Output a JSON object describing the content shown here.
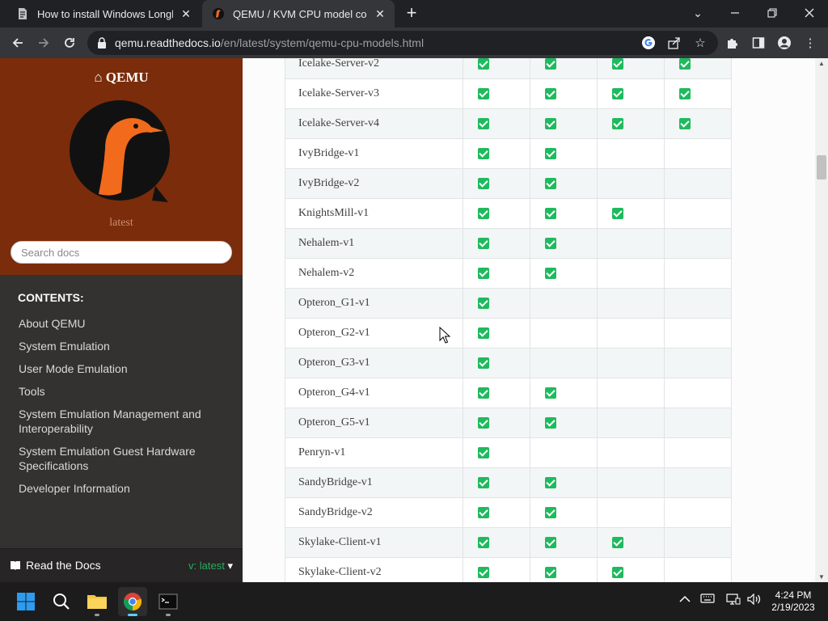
{
  "browser": {
    "tabs": [
      {
        "title": "How to install Windows Longhorn",
        "active": false
      },
      {
        "title": "QEMU / KVM CPU model configuration",
        "active": true
      }
    ],
    "new_tab": "+",
    "url_host": "qemu.readthedocs.io",
    "url_path": "/en/latest/system/qemu-cpu-models.html"
  },
  "sidebar": {
    "project": "QEMU",
    "version": "latest",
    "search_placeholder": "Search docs",
    "caption": "CONTENTS:",
    "nav": [
      "About QEMU",
      "System Emulation",
      "User Mode Emulation",
      "Tools",
      "System Emulation Management and Interoperability",
      "System Emulation Guest Hardware Specifications",
      "Developer Information"
    ],
    "footer_label": "Read the Docs",
    "footer_version": "v: latest"
  },
  "table": {
    "rows": [
      {
        "name": "Icelake-Server-v2",
        "checks": [
          true,
          true,
          true,
          true
        ]
      },
      {
        "name": "Icelake-Server-v3",
        "checks": [
          true,
          true,
          true,
          true
        ]
      },
      {
        "name": "Icelake-Server-v4",
        "checks": [
          true,
          true,
          true,
          true
        ]
      },
      {
        "name": "IvyBridge-v1",
        "checks": [
          true,
          true,
          false,
          false
        ]
      },
      {
        "name": "IvyBridge-v2",
        "checks": [
          true,
          true,
          false,
          false
        ]
      },
      {
        "name": "KnightsMill-v1",
        "checks": [
          true,
          true,
          true,
          false
        ]
      },
      {
        "name": "Nehalem-v1",
        "checks": [
          true,
          true,
          false,
          false
        ]
      },
      {
        "name": "Nehalem-v2",
        "checks": [
          true,
          true,
          false,
          false
        ]
      },
      {
        "name": "Opteron_G1-v1",
        "checks": [
          true,
          false,
          false,
          false
        ]
      },
      {
        "name": "Opteron_G2-v1",
        "checks": [
          true,
          false,
          false,
          false
        ]
      },
      {
        "name": "Opteron_G3-v1",
        "checks": [
          true,
          false,
          false,
          false
        ]
      },
      {
        "name": "Opteron_G4-v1",
        "checks": [
          true,
          true,
          false,
          false
        ]
      },
      {
        "name": "Opteron_G5-v1",
        "checks": [
          true,
          true,
          false,
          false
        ]
      },
      {
        "name": "Penryn-v1",
        "checks": [
          true,
          false,
          false,
          false
        ]
      },
      {
        "name": "SandyBridge-v1",
        "checks": [
          true,
          true,
          false,
          false
        ]
      },
      {
        "name": "SandyBridge-v2",
        "checks": [
          true,
          true,
          false,
          false
        ]
      },
      {
        "name": "Skylake-Client-v1",
        "checks": [
          true,
          true,
          true,
          false
        ]
      },
      {
        "name": "Skylake-Client-v2",
        "checks": [
          true,
          true,
          true,
          false
        ]
      }
    ]
  },
  "taskbar": {
    "time": "4:24 PM",
    "date": "2/19/2023"
  },
  "colors": {
    "sidebar_top": "#7a2c0b",
    "sidebar_bg": "#343131",
    "check_green": "#1fba5e",
    "chrome_dark": "#202124"
  }
}
